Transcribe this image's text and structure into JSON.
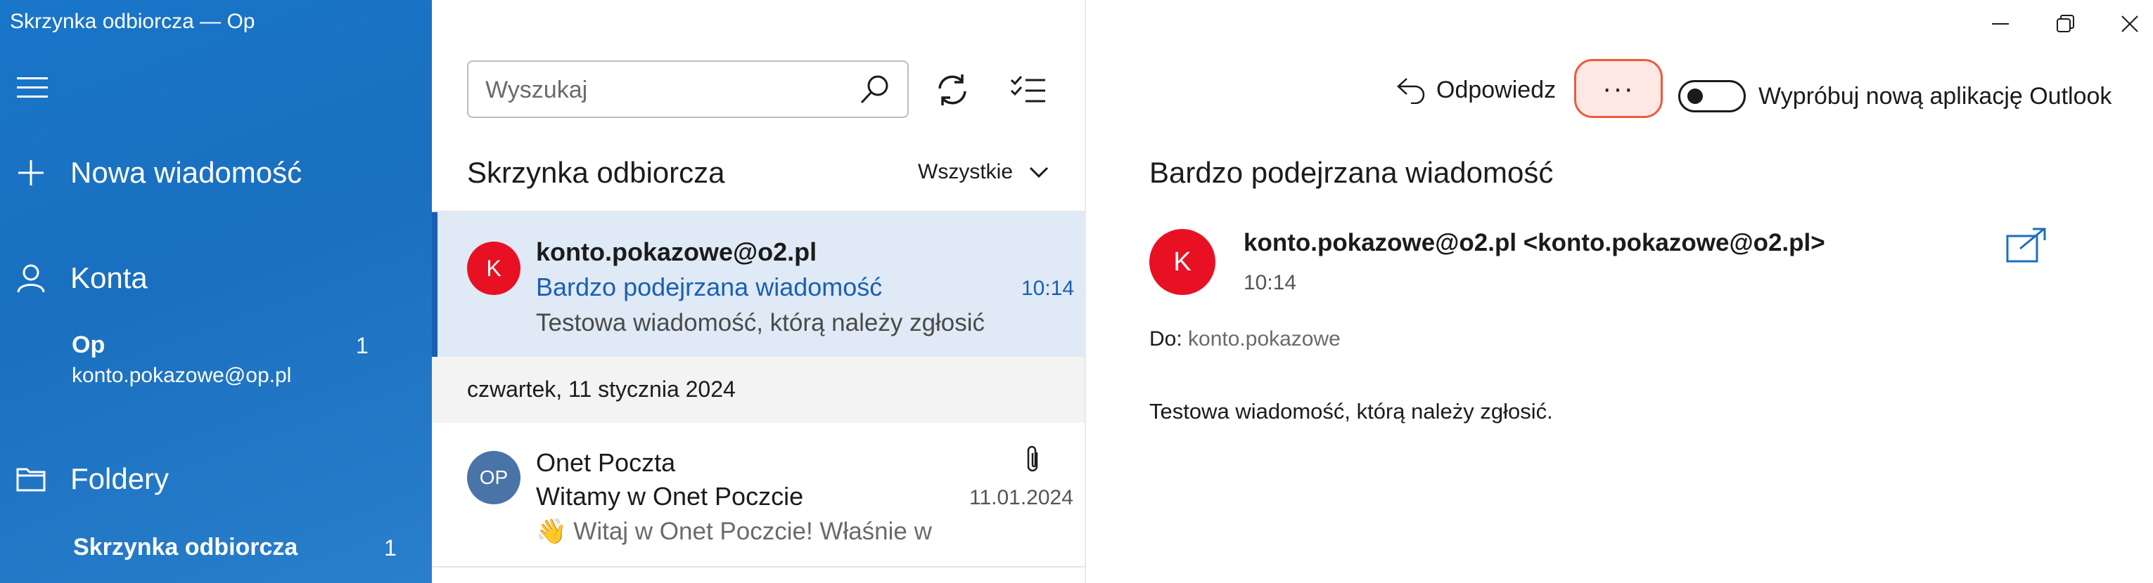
{
  "window": {
    "title": "Skrzynka odbiorcza — Op"
  },
  "sidebar": {
    "new_message": "Nowa wiadomość",
    "accounts_label": "Konta",
    "account": {
      "name": "Op",
      "email": "konto.pokazowe@op.pl",
      "unread": "1"
    },
    "folders_label": "Foldery",
    "folder": {
      "name": "Skrzynka odbiorcza",
      "unread": "1"
    },
    "background_color": "#1a6fbf"
  },
  "list": {
    "search_placeholder": "Wyszukaj",
    "title": "Skrzynka odbiorcza",
    "filter": "Wszystkie",
    "messages": [
      {
        "avatar": "K",
        "avatar_color": "#e81123",
        "sender": "konto.pokazowe@o2.pl",
        "subject": "Bardzo podejrzana wiadomość",
        "preview": "Testowa wiadomość, którą należy zgłosić",
        "time": "10:14",
        "selected": true
      },
      {
        "avatar": "OP",
        "avatar_color": "#4a73a8",
        "sender": "Onet Poczta",
        "subject": "Witamy w Onet Poczcie",
        "preview": "👋 Witaj w Onet Poczcie! Właśnie w",
        "time": "11.01.2024",
        "has_attachment": true
      }
    ],
    "date_group": "czwartek, 11 stycznia 2024"
  },
  "reading": {
    "reply_label": "Odpowiedz",
    "more_label": "···",
    "toggle_label": "Wypróbuj nową aplikację Outlook",
    "toggle_on": false,
    "subject": "Bardzo podejrzana wiadomość",
    "from": "konto.pokazowe@o2.pl <konto.pokazowe@o2.pl>",
    "avatar": "K",
    "time": "10:14",
    "to_prefix": "Do:",
    "to_value": "konto.pokazowe",
    "body": "Testowa wiadomość, którą należy zgłosić."
  }
}
